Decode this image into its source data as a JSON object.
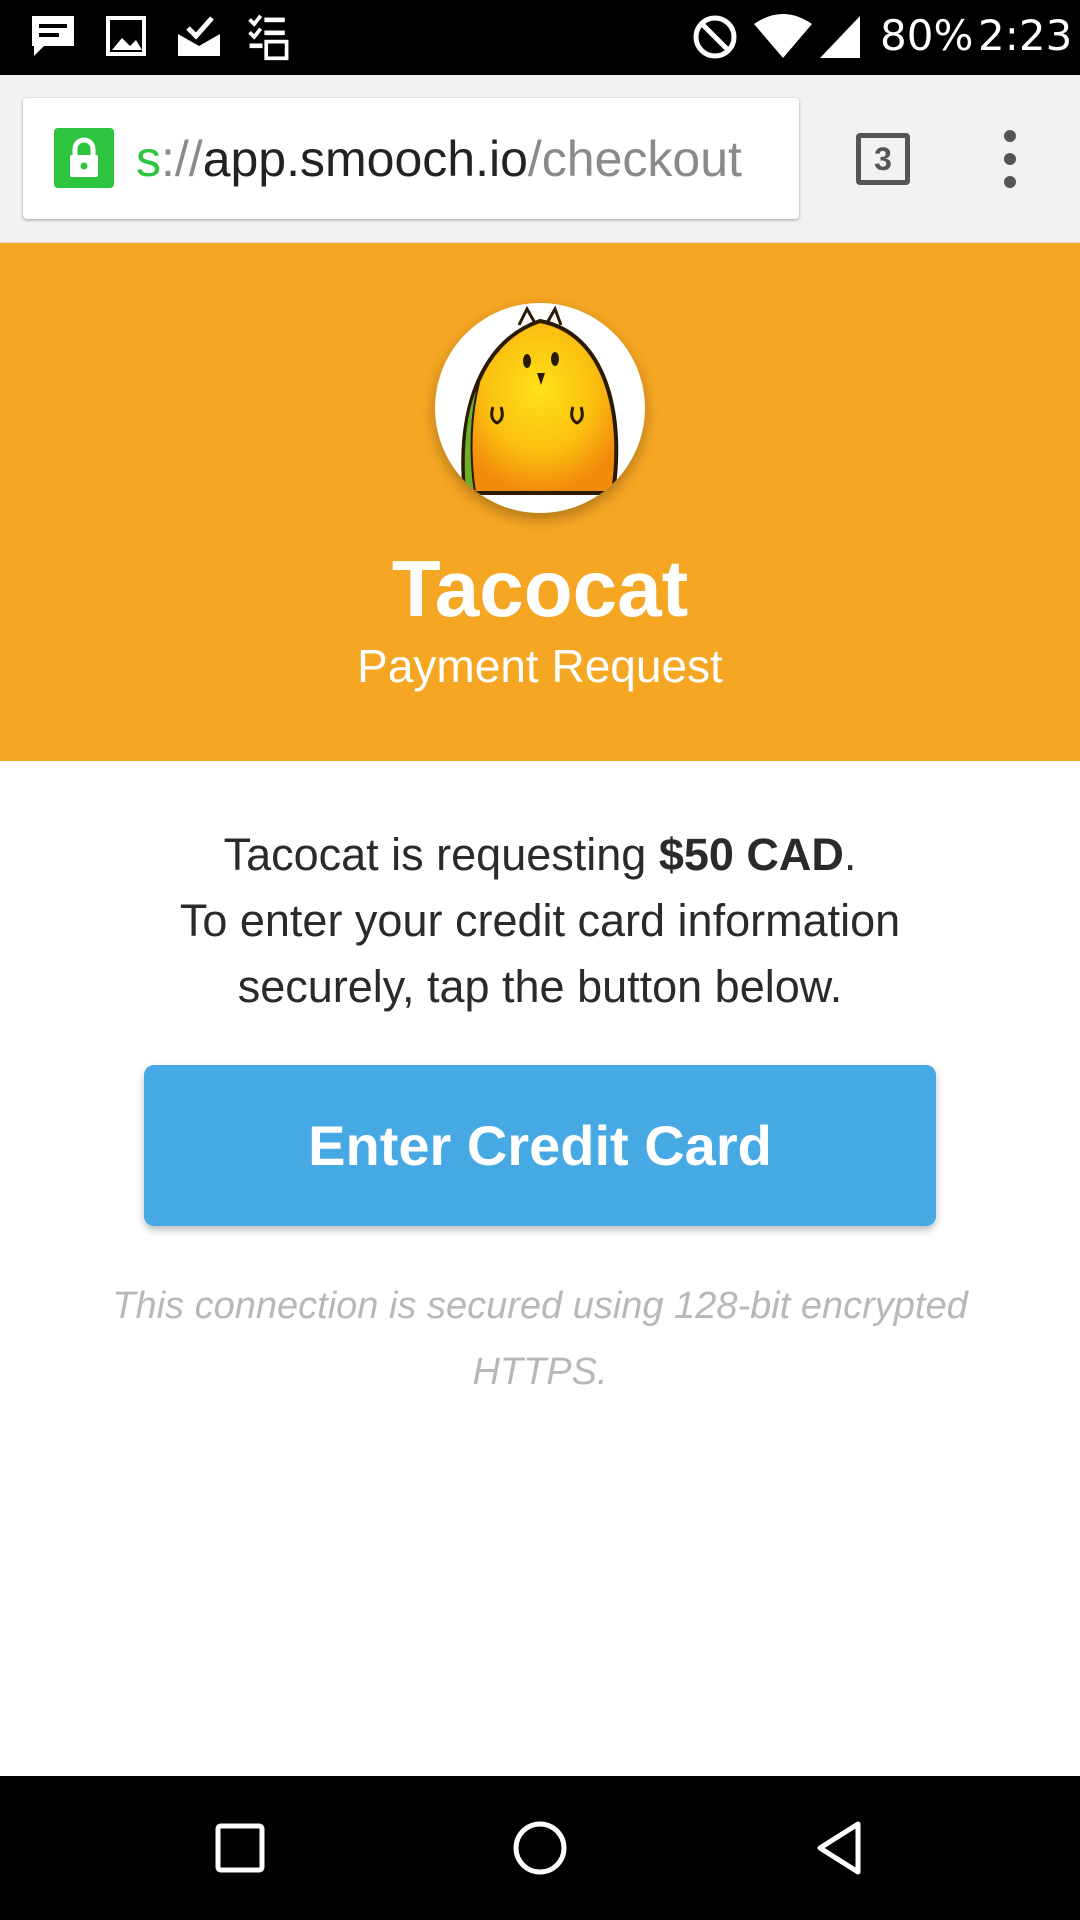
{
  "status_bar": {
    "battery": "80%",
    "time": "2:23",
    "notification_icons": [
      "message-icon",
      "image-icon",
      "mail-check-icon",
      "tasks-icon"
    ],
    "system_icons": [
      "do-not-disturb-icon",
      "wifi-icon",
      "signal-icon"
    ]
  },
  "browser": {
    "url": {
      "scheme": "s",
      "separator": "://",
      "host": "app.smooch.io",
      "path": "/checkout"
    },
    "tab_count": "3"
  },
  "banner": {
    "app_name": "Tacocat",
    "subtitle": "Payment Request"
  },
  "content": {
    "message_prefix": "Tacocat is requesting ",
    "amount": "$50 CAD",
    "message_suffix": ".",
    "message_line2": "To enter your credit card information securely, tap the button below.",
    "button_label": "Enter Credit Card",
    "secure_note": "This connection is secured using 128-bit encrypted HTTPS."
  },
  "colors": {
    "banner": "#f5a623",
    "button": "#47a9e3",
    "lock": "#2dc43f"
  }
}
